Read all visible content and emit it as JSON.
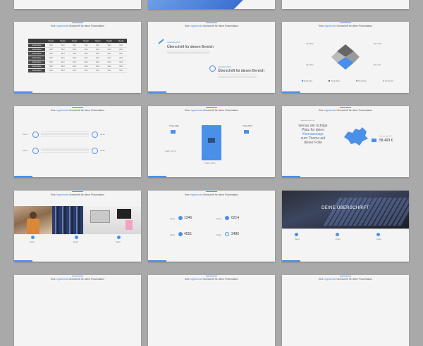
{
  "header": {
    "prefix": "Eine",
    "highlight": "Ingestende",
    "suffix": "Überschrift für deine Präsentation"
  },
  "slide_text_title": {
    "small_a": "Unterüberschrift",
    "title_a": "Überschrift für diesen Bereich",
    "small_b": "Unterüberschrift",
    "title_b": "Überschrift für diesen Bereich"
  },
  "table": {
    "headers": [
      "",
      "Header",
      "Header",
      "Header",
      "Header",
      "Header",
      "Header",
      "Header"
    ],
    "rows": [
      [
        "Zeilenname",
        "Wert",
        "Wert",
        "Wert",
        "Wert",
        "Wert",
        "Wert",
        "Wert"
      ],
      [
        "Zeilenname",
        "Wert",
        "Wert",
        "Wert",
        "Wert",
        "Wert",
        "Wert",
        "Wert"
      ],
      [
        "Zeilenname",
        "Wert",
        "Wert",
        "Wert",
        "Wert",
        "Wert",
        "Wert",
        "Wert"
      ],
      [
        "Zeilenname",
        "Wert",
        "Wert",
        "Wert",
        "Wert",
        "Wert",
        "Wert",
        "Wert"
      ],
      [
        "Zeilenname",
        "Wert",
        "Wert",
        "Wert",
        "Wert",
        "Wert",
        "Wert",
        "Wert"
      ],
      [
        "Zeilenname",
        "Wert",
        "Wert",
        "Wert",
        "Wert",
        "Wert",
        "Wert",
        "Wert"
      ],
      [
        "Zeilenname",
        "Wert",
        "Wert",
        "Wert",
        "Wert",
        "Wert",
        "Wert",
        "Wert"
      ]
    ]
  },
  "diagram_slide": {
    "labels": [
      "Idee Eins",
      "Idee Zwei",
      "Idee Drei",
      "Idee Vier"
    ],
    "legend": [
      "Punkt Eins",
      "Punkt Zwei",
      "Punkt Drei",
      "Punkt Vier"
    ]
  },
  "feature_slide": {
    "labels": [
      "Punkt",
      "Punkt",
      "Punkt",
      "Punkt"
    ]
  },
  "phone_slide": {
    "left_title": "TITLE ONE",
    "right_title": "TITLE TWO",
    "left_value": "1.900 = 87 %",
    "bottom_value": "1.900 = 53 %"
  },
  "map_slide": {
    "text_line1": "Genau der richtige",
    "text_line2": "Platz für deine",
    "text_line3": "Kernaussage",
    "text_line4": "zum Thema auf",
    "text_line5": "dieser Folie",
    "small_label": "Kernaussage Zahl",
    "value": "58.493 €",
    "kicker": "Unterüberschrift Text"
  },
  "photo_slide": {
    "labels": [
      "Punkt",
      "Punkt",
      "Punkt"
    ]
  },
  "numbers_slide": {
    "labels": [
      "Punkt",
      "Punkt",
      "Punkt",
      "Punkt"
    ],
    "values": [
      "1346",
      "6214",
      "4551",
      "3485"
    ]
  },
  "dark_slide": {
    "title": "DEINE ÜBERSCHRIFT",
    "labels": [
      "Punkt",
      "Punkt",
      "Punkt"
    ]
  },
  "colors": {
    "accent": "#4a8fe8",
    "background": "#a9a9a9",
    "slide": "#f4f4f4",
    "dark": "#3b3b3b"
  }
}
